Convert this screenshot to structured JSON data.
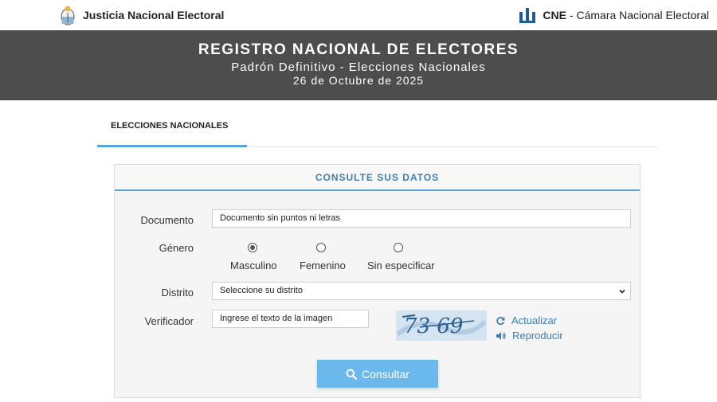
{
  "header": {
    "left_brand": "Justicia Nacional Electoral",
    "right_brand_bold": "CNE",
    "right_brand_rest": "- Cámara Nacional Electoral"
  },
  "hero": {
    "title": "REGISTRO NACIONAL DE ELECTORES",
    "subtitle": "Padrón Definitivo - Elecciones Nacionales",
    "date": "26 de Octubre de 2025"
  },
  "tabs": [
    {
      "label": "ELECCIONES NACIONALES",
      "active": true
    }
  ],
  "form": {
    "heading": "CONSULTE SUS DATOS",
    "documento": {
      "label": "Documento",
      "placeholder": "Documento sin puntos ni letras"
    },
    "genero": {
      "label": "Género",
      "options": [
        {
          "label": "Masculino",
          "checked": true
        },
        {
          "label": "Femenino",
          "checked": false
        },
        {
          "label": "Sin especificar",
          "checked": false
        }
      ]
    },
    "distrito": {
      "label": "Distrito",
      "selected": "Seleccione su distrito"
    },
    "verificador": {
      "label": "Verificador",
      "placeholder": "Ingrese el texto de la imagen",
      "captcha_text": "73 69",
      "refresh_label": "Actualizar",
      "play_label": "Reproducir"
    },
    "submit_label": "Consultar"
  },
  "colors": {
    "hero_bg": "#4d4d4d",
    "accent": "#5aa4d8",
    "link": "#3e7fb1",
    "button": "#6bb9ec"
  }
}
